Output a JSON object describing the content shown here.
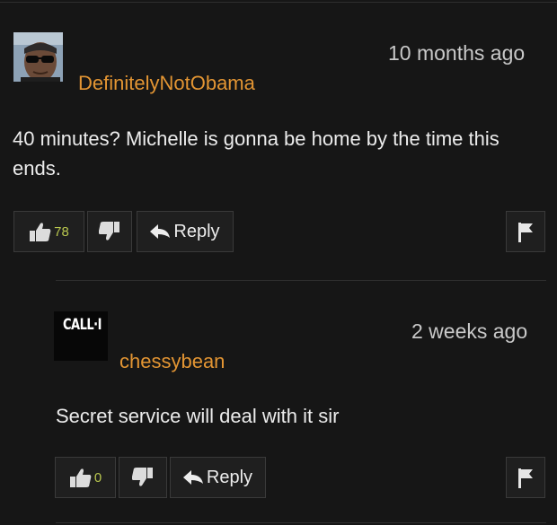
{
  "comments": [
    {
      "username": "DefinitelyNotObama",
      "timestamp": "10 months ago",
      "text": "40 minutes? Michelle is gonna be home by the time this ends.",
      "upvotes": "78",
      "reply_label": "Reply",
      "avatar_icon": "person-sunglasses-avatar"
    },
    {
      "username": "chessybean",
      "timestamp": "2 weeks ago",
      "text": "Secret service will deal with it sir",
      "upvotes": "0",
      "reply_label": "Reply",
      "avatar_text": "CALL·I",
      "avatar_icon": "call-of-duty-avatar"
    }
  ],
  "colors": {
    "background": "#161616",
    "username": "#e39533",
    "vote_count": "#b8c64e"
  }
}
